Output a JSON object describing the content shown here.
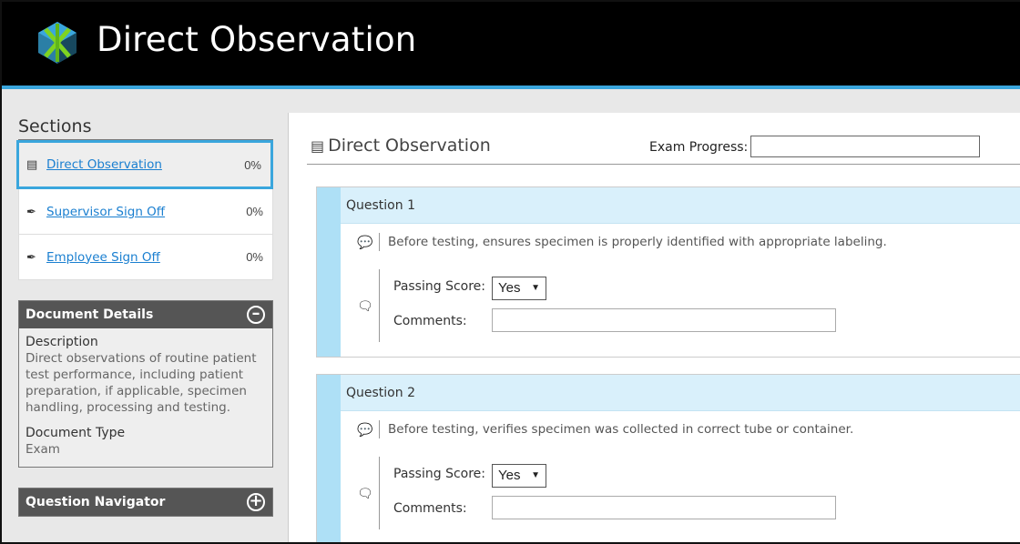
{
  "header": {
    "title": "Direct Observation",
    "brand_color": "#000000",
    "accent_color": "#3aa6dd"
  },
  "sidebar": {
    "sections_title": "Sections",
    "items": [
      {
        "icon": "document-icon",
        "label": "Direct Observation",
        "percent": "0%",
        "active": true
      },
      {
        "icon": "pen-icon",
        "label": "Supervisor Sign Off",
        "percent": "0%",
        "active": false
      },
      {
        "icon": "pen-icon",
        "label": "Employee Sign Off",
        "percent": "0%",
        "active": false
      }
    ],
    "document_details": {
      "title": "Document Details",
      "toggle_icon": "minus-circle-icon",
      "description_label": "Description",
      "description_value": "Direct observations of routine patient test performance, including patient preparation, if applicable, specimen handling, processing and testing.",
      "type_label": "Document Type",
      "type_value": "Exam"
    },
    "question_navigator": {
      "title": "Question Navigator",
      "toggle_icon": "plus-circle-icon"
    }
  },
  "main": {
    "title": "Direct Observation",
    "title_icon": "document-icon",
    "progress_label": "Exam Progress:",
    "questions": [
      {
        "header": "Question 1",
        "text": "Before testing, ensures specimen is properly identified with appropriate labeling.",
        "passing_label": "Passing Score:",
        "passing_value": "Yes",
        "comments_label": "Comments:",
        "comments_value": ""
      },
      {
        "header": "Question 2",
        "text": "Before testing, verifies specimen was collected in correct tube or container.",
        "passing_label": "Passing Score:",
        "passing_value": "Yes",
        "comments_label": "Comments:",
        "comments_value": ""
      }
    ]
  }
}
